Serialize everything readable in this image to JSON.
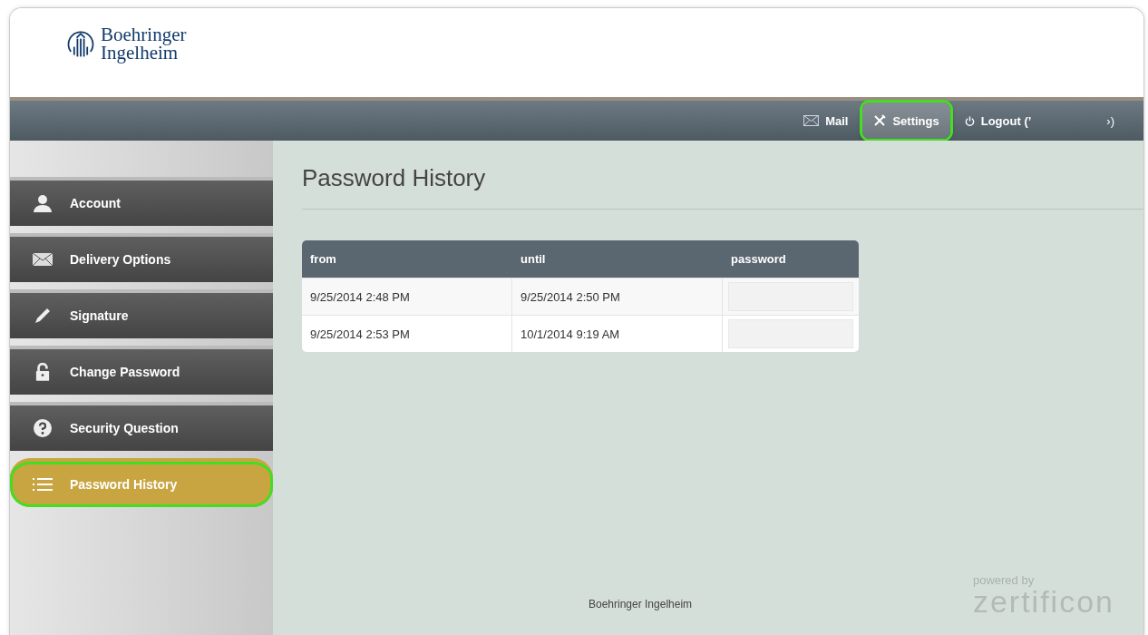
{
  "logo": {
    "line_1": "Boehringer",
    "line_2": "Ingelheim"
  },
  "top_nav": [
    {
      "kind": "mail",
      "label": "Mail",
      "selected": false,
      "highlighted": false
    },
    {
      "kind": "settings",
      "label": "Settings",
      "selected": true,
      "highlighted": true
    },
    {
      "kind": "logout",
      "label": "Logout (’",
      "tail": "›)",
      "selected": false,
      "highlighted": false
    }
  ],
  "sidebar": {
    "items": [
      {
        "kind": "account",
        "label": "Account",
        "selected": false,
        "highlighted": false
      },
      {
        "kind": "delivery",
        "label": "Delivery Options",
        "selected": false,
        "highlighted": false
      },
      {
        "kind": "signature",
        "label": "Signature",
        "selected": false,
        "highlighted": false
      },
      {
        "kind": "password",
        "label": "Change Password",
        "selected": false,
        "highlighted": false
      },
      {
        "kind": "question",
        "label": "Security Question",
        "selected": false,
        "highlighted": false
      },
      {
        "kind": "history",
        "label": "Password History",
        "selected": true,
        "highlighted": true
      }
    ]
  },
  "page_title": "Password History",
  "table": {
    "columns": [
      "from",
      "until",
      "password"
    ],
    "rows": [
      [
        "9/25/2014 2:48 PM",
        "9/25/2014 2:50 PM"
      ],
      [
        "9/25/2014 2:53 PM",
        "10/1/2014 9:19 AM"
      ]
    ]
  },
  "footer": {
    "text": "Boehringer Ingelheim",
    "powered_by": "powered by",
    "brand": "zertificon"
  }
}
